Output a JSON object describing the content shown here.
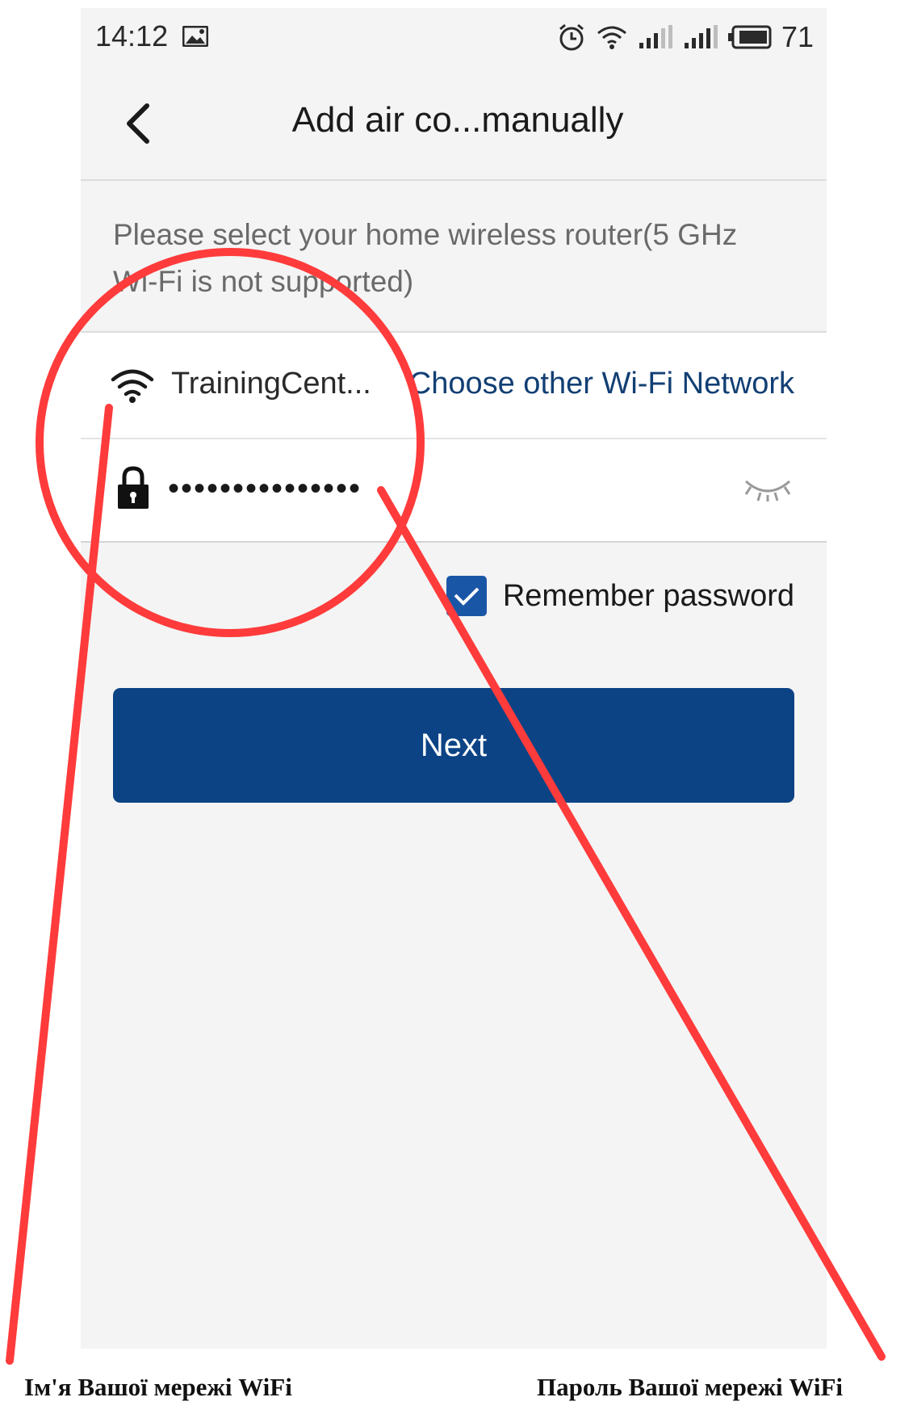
{
  "status_bar": {
    "time": "14:12",
    "battery": "71",
    "icons": [
      "gallery-icon",
      "alarm-icon",
      "wifi-status-icon",
      "signal-icon",
      "signal-icon",
      "battery-icon"
    ]
  },
  "header": {
    "title": "Add air co...manually",
    "back_icon": "chevron-left-icon"
  },
  "instruction": "Please select your home wireless router(5 GHz Wi-Fi is not supported)",
  "wifi": {
    "network_name": "TrainingCent...",
    "choose_other": "Choose other Wi-Fi Network",
    "password_value": "•••••••••••••••",
    "remember_label": "Remember password",
    "remember_checked": true
  },
  "actions": {
    "next_label": "Next"
  },
  "annotations": {
    "left_caption": "Ім'я Вашої мережі WiFi",
    "right_caption": "Пароль Вашої мережі WiFi",
    "color": "#ff3b3b"
  },
  "colors": {
    "primary": "#0b4385",
    "link": "#123f74",
    "checkbox": "#1a56a6",
    "background": "#f4f4f4"
  }
}
